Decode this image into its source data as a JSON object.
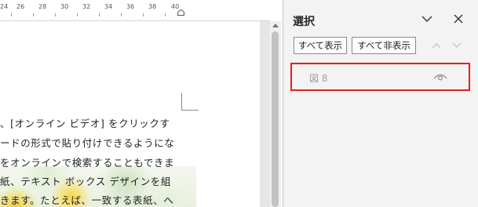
{
  "ruler": {
    "numbers": [
      "24",
      "26",
      "28",
      "30",
      "32",
      "34",
      "36",
      "38",
      "40"
    ]
  },
  "document": {
    "lines": [
      "、[オンライン ビデオ] をクリックす",
      "ードの形式で貼り付けできるようにな",
      "をオンラインで検索することもできま",
      "紙、テキスト ボックス デザインを組",
      "きます。たとえば、一致する表紙、へ"
    ]
  },
  "selection_pane": {
    "title": "選択",
    "show_all_label": "すべて表示",
    "hide_all_label": "すべて非表示",
    "items": [
      {
        "label": "図 8",
        "visible": true
      }
    ]
  },
  "colors": {
    "highlight_border": "#e41e1e",
    "pane_background": "#f3f3f3",
    "item_text": "#a0a0a0"
  },
  "icons": [
    "chevron-down-icon",
    "close-icon",
    "bring-forward-icon",
    "send-backward-icon",
    "eye-icon",
    "scroll-up-arrow-icon"
  ]
}
